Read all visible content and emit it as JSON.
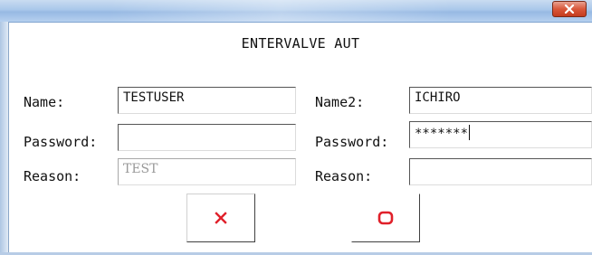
{
  "dialog": {
    "title": "ENTERVALVE AUT"
  },
  "left": {
    "name_label": "Name:",
    "name_value": "TESTUSER",
    "password_label": "Password:",
    "password_value": "",
    "reason_label": "Reason:",
    "reason_value": "TEST"
  },
  "right": {
    "name_label": "Name2:",
    "name_value": "ICHIRO",
    "password_label": "Password:",
    "password_value": "*******",
    "reason_label": "Reason:",
    "reason_value": ""
  },
  "icons": {
    "window_close": "window-close-icon",
    "cancel": "red-x-icon",
    "confirm": "red-rounded-square-icon"
  },
  "colors": {
    "accent_red": "#e0202a",
    "titlebar_blue": "#a9c7ea",
    "close_button": "#d9573a"
  }
}
